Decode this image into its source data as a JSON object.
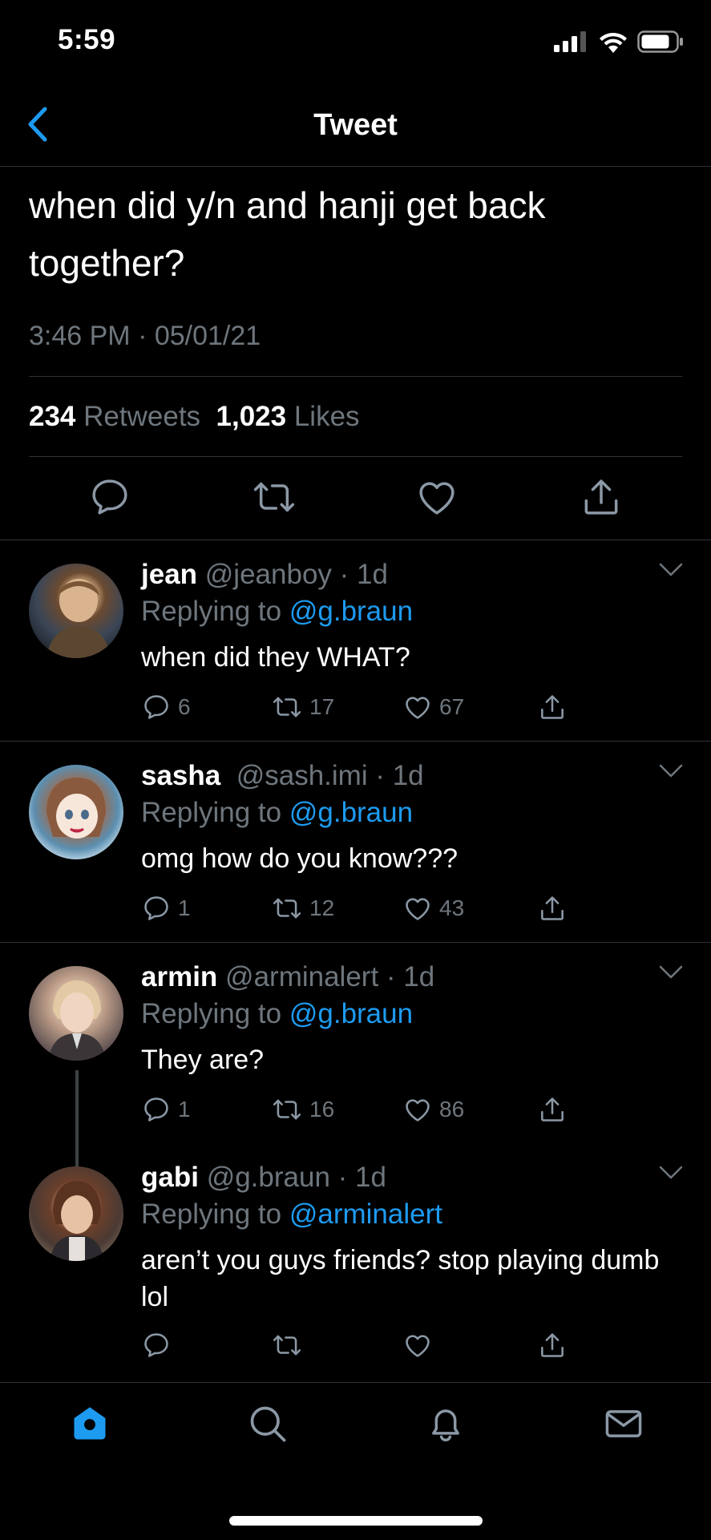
{
  "status_bar": {
    "time": "5:59"
  },
  "nav": {
    "title": "Tweet",
    "back_icon": "chevron-left-icon",
    "accent": "#1d9bf0"
  },
  "tweet": {
    "text": "when did y/n and hanji get back together?",
    "timestamp": "3:46 PM · 05/01/21",
    "retweets_count": "234",
    "retweets_label": "Retweets",
    "likes_count": "1,023",
    "likes_label": "Likes"
  },
  "replies": [
    {
      "name": "jean",
      "handle": "@jeanboy",
      "age": "1d",
      "replying_prefix": "Replying to",
      "replying_to": "@g.braun",
      "text": "when did they WHAT?",
      "comments": "6",
      "retweets": "17",
      "likes": "67"
    },
    {
      "name": "sasha",
      "handle": "@sash.imi",
      "age": "1d",
      "replying_prefix": "Replying to",
      "replying_to": "@g.braun",
      "text": "omg how do you know???",
      "comments": "1",
      "retweets": "12",
      "likes": "43"
    },
    {
      "name": "armin",
      "handle": "@arminalert",
      "age": "1d",
      "replying_prefix": "Replying to",
      "replying_to": "@g.braun",
      "text": "They are?",
      "comments": "1",
      "retweets": "16",
      "likes": "86"
    },
    {
      "name": "gabi",
      "handle": "@g.braun",
      "age": "1d",
      "replying_prefix": "Replying to",
      "replying_to": "@arminalert",
      "text": "aren’t you guys friends? stop playing dumb lol",
      "comments": "",
      "retweets": "",
      "likes": ""
    }
  ],
  "tab_bar": {
    "items": [
      "home-icon",
      "search-icon",
      "bell-icon",
      "mail-icon"
    ],
    "active": "home-icon"
  }
}
